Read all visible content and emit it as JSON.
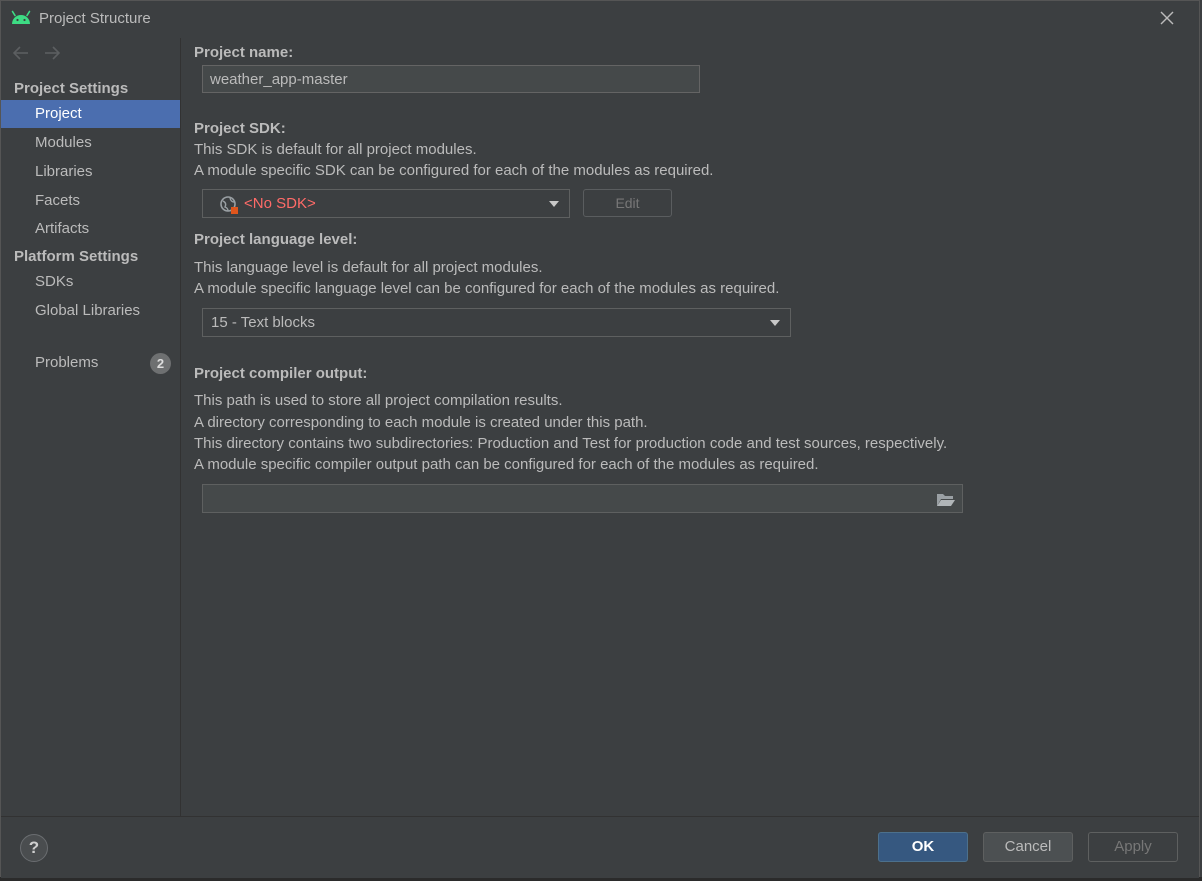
{
  "window": {
    "title": "Project Structure",
    "app_icon": "android-icon",
    "close_icon": "close-icon"
  },
  "sidebar": {
    "back_icon": "arrow-left-icon",
    "forward_icon": "arrow-right-icon",
    "project_settings_header": "Project Settings",
    "project_settings_items": [
      {
        "label": "Project",
        "selected": true
      },
      {
        "label": "Modules"
      },
      {
        "label": "Libraries"
      },
      {
        "label": "Facets"
      },
      {
        "label": "Artifacts"
      }
    ],
    "platform_settings_header": "Platform Settings",
    "platform_settings_items": [
      {
        "label": "SDKs"
      },
      {
        "label": "Global Libraries"
      }
    ],
    "problems": {
      "label": "Problems",
      "count": "2"
    }
  },
  "main": {
    "project_name": {
      "label": "Project name:",
      "value": "weather_app-master"
    },
    "project_sdk": {
      "label": "Project SDK:",
      "desc_1": "This SDK is default for all project modules.",
      "desc_2": "A module specific SDK can be configured for each of the modules as required.",
      "selected": "<No SDK>",
      "edit_label": "Edit"
    },
    "language_level": {
      "label": "Project language level:",
      "desc_1": "This language level is default for all project modules.",
      "desc_2": "A module specific language level can be configured for each of the modules as required.",
      "selected": "15 - Text blocks"
    },
    "compiler_output": {
      "label": "Project compiler output:",
      "desc_1": "This path is used to store all project compilation results.",
      "desc_2": "A directory corresponding to each module is created under this path.",
      "desc_3": "This directory contains two subdirectories: Production and Test for production code and test sources, respectively.",
      "desc_4": "A module specific compiler output path can be configured for each of the modules as required.",
      "value": "",
      "folder_icon": "folder-open-icon"
    }
  },
  "footer": {
    "help_label": "?",
    "ok_label": "OK",
    "cancel_label": "Cancel",
    "apply_label": "Apply"
  },
  "colors": {
    "background": "#3c3f41",
    "selection": "#4b6eaf",
    "error_text": "#ff6b68",
    "android_green": "#3ddc84",
    "primary_button": "#365880"
  }
}
